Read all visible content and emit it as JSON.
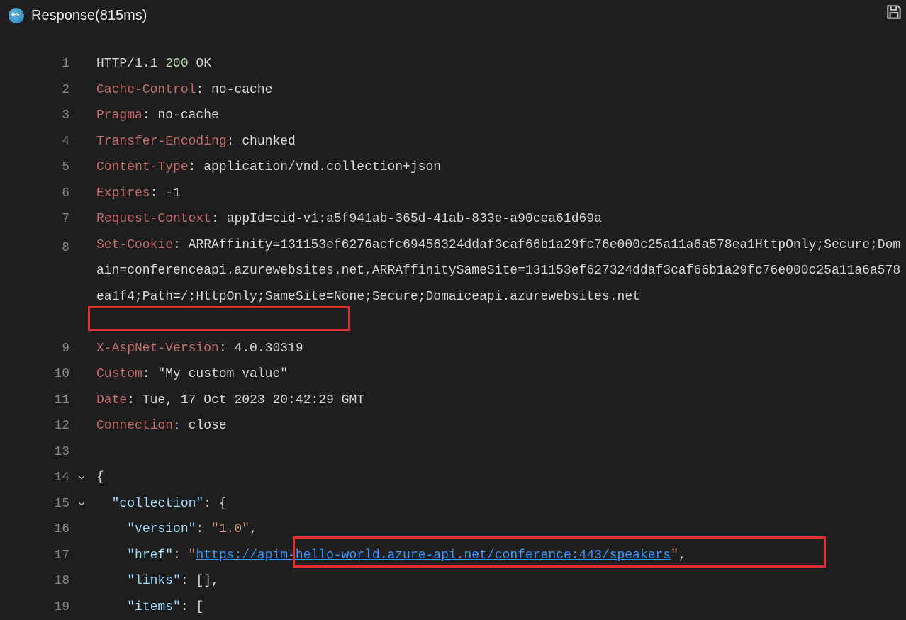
{
  "header": {
    "icon_label": "REST",
    "title": "Response(815ms)"
  },
  "lines": [
    {
      "num": "1",
      "parts": [
        {
          "t": "HTTP",
          "c": "c-txt"
        },
        {
          "t": "/",
          "c": "c-txt"
        },
        {
          "t": "1.1 ",
          "c": "c-txt"
        },
        {
          "t": "200",
          "c": "c-num"
        },
        {
          "t": " OK",
          "c": "c-txt"
        }
      ]
    },
    {
      "num": "2",
      "parts": [
        {
          "t": "Cache-Control",
          "c": "c-key"
        },
        {
          "t": ": ",
          "c": "c-punc"
        },
        {
          "t": "no-cache",
          "c": "c-txt"
        }
      ]
    },
    {
      "num": "3",
      "parts": [
        {
          "t": "Pragma",
          "c": "c-key"
        },
        {
          "t": ": ",
          "c": "c-punc"
        },
        {
          "t": "no-cache",
          "c": "c-txt"
        }
      ]
    },
    {
      "num": "4",
      "parts": [
        {
          "t": "Transfer-Encoding",
          "c": "c-key"
        },
        {
          "t": ": ",
          "c": "c-punc"
        },
        {
          "t": "chunked",
          "c": "c-txt"
        }
      ]
    },
    {
      "num": "5",
      "parts": [
        {
          "t": "Content-Type",
          "c": "c-key"
        },
        {
          "t": ": ",
          "c": "c-punc"
        },
        {
          "t": "application/vnd.collection+json",
          "c": "c-txt"
        }
      ]
    },
    {
      "num": "6",
      "parts": [
        {
          "t": "Expires",
          "c": "c-key"
        },
        {
          "t": ": ",
          "c": "c-punc"
        },
        {
          "t": "-1",
          "c": "c-txt"
        }
      ]
    },
    {
      "num": "7",
      "parts": [
        {
          "t": "Request-Context",
          "c": "c-key"
        },
        {
          "t": ": ",
          "c": "c-punc"
        },
        {
          "t": "appId=cid-v1:a5f941ab-365d-41ab-833e-a90cea61d69a",
          "c": "c-txt"
        }
      ]
    },
    {
      "num": "8",
      "wrap": true,
      "parts": [
        {
          "t": "Set-Cookie",
          "c": "c-key"
        },
        {
          "t": ": ",
          "c": "c-punc"
        },
        {
          "t": "ARRAffinity=131153ef6276acfc69456324ddaf3caf66b1a29fc76e000c25a11a6a578ea1HttpOnly;Secure;Domain=conferenceapi.azurewebsites.net,ARRAffinitySameSite=131153ef627324ddaf3caf66b1a29fc76e000c25a11a6a578ea1f4;Path=/;HttpOnly;SameSite=None;Secure;Domaiceapi.azurewebsites.net",
          "c": "c-txt"
        }
      ]
    },
    {
      "num": "9",
      "parts": [
        {
          "t": "X-AspNet-Version",
          "c": "c-key"
        },
        {
          "t": ": ",
          "c": "c-punc"
        },
        {
          "t": "4.0.30319",
          "c": "c-txt"
        }
      ]
    },
    {
      "num": "10",
      "parts": [
        {
          "t": "Custom",
          "c": "c-key"
        },
        {
          "t": ": ",
          "c": "c-punc"
        },
        {
          "t": "\"My custom value\"",
          "c": "c-txt"
        }
      ]
    },
    {
      "num": "11",
      "parts": [
        {
          "t": "Date",
          "c": "c-key"
        },
        {
          "t": ": ",
          "c": "c-punc"
        },
        {
          "t": "Tue, 17 Oct 2023 20:42:29 GMT",
          "c": "c-txt"
        }
      ]
    },
    {
      "num": "12",
      "parts": [
        {
          "t": "Connection",
          "c": "c-key"
        },
        {
          "t": ": ",
          "c": "c-punc"
        },
        {
          "t": "close",
          "c": "c-txt"
        }
      ]
    },
    {
      "num": "13",
      "parts": [
        {
          "t": "",
          "c": "c-txt"
        }
      ]
    },
    {
      "num": "14",
      "fold": true,
      "parts": [
        {
          "t": "{",
          "c": "c-punc"
        }
      ]
    },
    {
      "num": "15",
      "fold": true,
      "parts": [
        {
          "t": "  ",
          "c": "c-txt"
        },
        {
          "t": "\"collection\"",
          "c": "c-prop"
        },
        {
          "t": ": {",
          "c": "c-punc"
        }
      ]
    },
    {
      "num": "16",
      "parts": [
        {
          "t": "    ",
          "c": "c-txt"
        },
        {
          "t": "\"version\"",
          "c": "c-prop"
        },
        {
          "t": ": ",
          "c": "c-punc"
        },
        {
          "t": "\"1.0\"",
          "c": "c-str"
        },
        {
          "t": ",",
          "c": "c-punc"
        }
      ]
    },
    {
      "num": "17",
      "parts": [
        {
          "t": "    ",
          "c": "c-txt"
        },
        {
          "t": "\"href\"",
          "c": "c-prop"
        },
        {
          "t": ": ",
          "c": "c-punc"
        },
        {
          "t": "\"",
          "c": "c-str"
        },
        {
          "t": "https://apim-hello-world.azure-api.net/conference:443/speakers",
          "c": "c-link"
        },
        {
          "t": "\"",
          "c": "c-str"
        },
        {
          "t": ",",
          "c": "c-punc"
        }
      ]
    },
    {
      "num": "18",
      "parts": [
        {
          "t": "    ",
          "c": "c-txt"
        },
        {
          "t": "\"links\"",
          "c": "c-prop"
        },
        {
          "t": ": [],",
          "c": "c-punc"
        }
      ]
    },
    {
      "num": "19",
      "parts": [
        {
          "t": "    ",
          "c": "c-txt"
        },
        {
          "t": "\"items\"",
          "c": "c-prop"
        },
        {
          "t": ": [",
          "c": "c-punc"
        }
      ]
    }
  ]
}
